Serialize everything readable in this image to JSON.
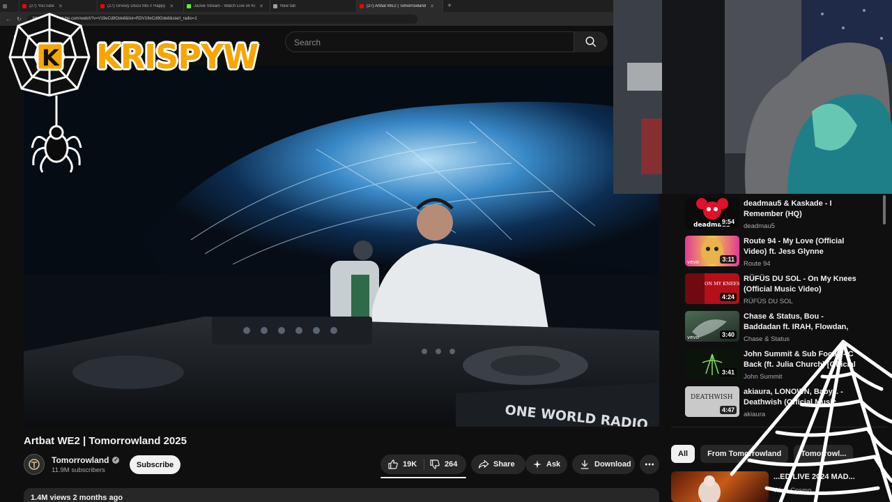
{
  "browser": {
    "tabs": [
      {
        "label": "(27) YouTube",
        "color": "#ff0000"
      },
      {
        "label": "(27) Groovy Disco Mix // Happy",
        "color": "#ff0000"
      },
      {
        "label": "Jackie Stream - Watch Live on Ki",
        "color": "#53fc18"
      },
      {
        "label": "New tab",
        "color": "#9aa0a6"
      },
      {
        "label": "(27) Artbat WE2 | Tomorrowland",
        "color": "#ff0000"
      }
    ],
    "url": "https://www.youtube.com/watch?v=V19eCd8Ode8&list=RDV19eCd8Ode8&start_radio=1"
  },
  "header": {
    "search_placeholder": "Search"
  },
  "overlay": {
    "logo_text": "KRISPYW"
  },
  "video": {
    "title": "Artbat WE2 | Tomorrowland 2025",
    "channel": "Tomorrowland",
    "subscribers": "11.9M subscribers",
    "subscribe_label": "Subscribe",
    "likes": "19K",
    "dislikes": "264",
    "share_label": "Share",
    "ask_label": "Ask",
    "download_label": "Download",
    "views": "1.4M views  2 months ago",
    "stage_text": "ONE WORLD RADIO"
  },
  "sidebar": {
    "related": [
      {
        "title": "deadmau5 & Kaskade - I Remember (HQ)",
        "channel": "deadmau5",
        "duration": "9:54",
        "thumb_text": "deadmau5"
      },
      {
        "title": "Route 94 - My Love (Official Video) ft. Jess Glynne",
        "channel": "Route 94",
        "duration": "3:11",
        "thumb_text": "vevo"
      },
      {
        "title": "RÜFÜS DU SOL - On My Knees (Official Music Video)",
        "channel": "RÜFÜS DU SOL",
        "duration": "4:24",
        "thumb_text": "ON MY KNEES"
      },
      {
        "title": "Chase & Status, Bou - Baddadan ft. IRAH, Flowdan, Trigga,...",
        "channel": "Chase & Status",
        "duration": "3:40",
        "thumb_text": "vevo"
      },
      {
        "title": "John Summit & Sub Focus - C Back (ft. Julia Church) [Official",
        "channel": "John Summit",
        "duration": "3:41",
        "thumb_text": ""
      },
      {
        "title": "akiaura, LONOWN, Baby... - Deathwish (Official Music...",
        "channel": "akiaura",
        "duration": "4:47",
        "thumb_text": "DEATHWISH"
      }
    ],
    "chips": [
      "All",
      "From Tomorrowland",
      "Tomorrowl..."
    ],
    "bottom": {
      "title": "...ED LIVE 2024 MAD...",
      "channel": "Wind Cosmo"
    }
  }
}
